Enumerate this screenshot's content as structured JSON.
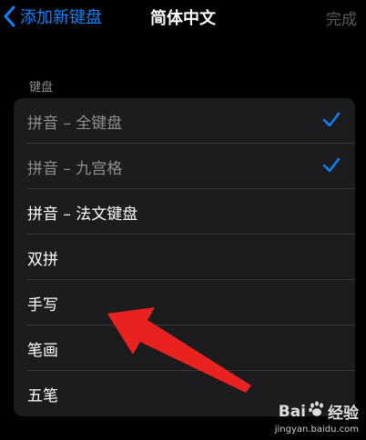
{
  "navbar": {
    "back_label": "添加新键盘",
    "title": "简体中文",
    "done_label": "完成"
  },
  "section": {
    "header": "键盘"
  },
  "keyboards": [
    {
      "label": "拼音 – 全键盘",
      "checked": true
    },
    {
      "label": "拼音 – 九宫格",
      "checked": true
    },
    {
      "label": "拼音 – 法文键盘",
      "checked": false
    },
    {
      "label": "双拼",
      "checked": false
    },
    {
      "label": "手写",
      "checked": false
    },
    {
      "label": "笔画",
      "checked": false
    },
    {
      "label": "五笔",
      "checked": false
    }
  ],
  "watermark": {
    "brand_left": "Bai",
    "brand_right": "经验",
    "url": "jingyan.baidu.com"
  },
  "colors": {
    "accent": "#0A84FF",
    "annotation": "#E8221F",
    "background": "#000000",
    "cell": "#1C1C1E"
  },
  "icons": {
    "back": "chevron-left-icon",
    "check": "checkmark-icon",
    "annotation": "red-arrow-pointer",
    "watermark": "baidu-paw-logo"
  }
}
